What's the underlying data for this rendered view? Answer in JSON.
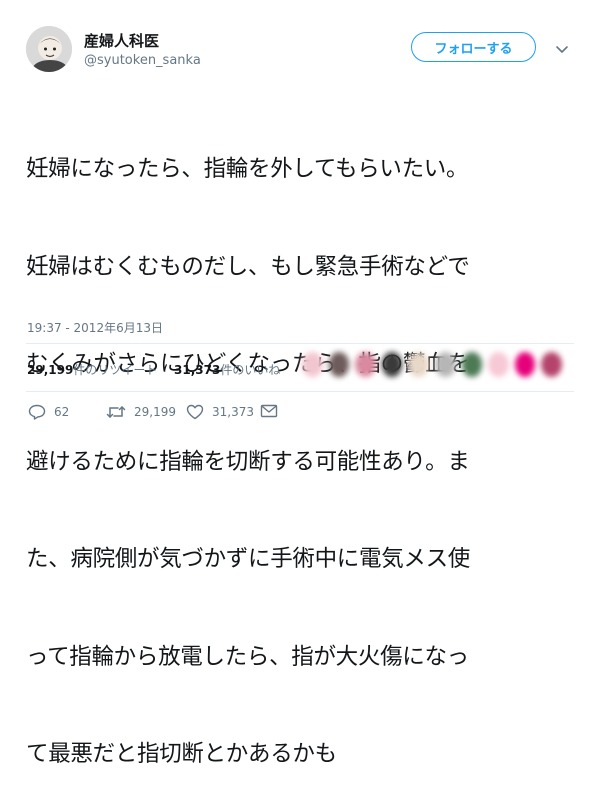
{
  "account": {
    "display_name": "産婦人科医",
    "handle": "@syutoken_sanka"
  },
  "follow_button_label": "フォローする",
  "tweet": {
    "lines": [
      "妊婦になったら、指輪を外してもらいたい。",
      "妊婦はむくむものだし、もし緊急手術などで",
      "むくみがさらにひどくなったら、指の鬱血を",
      "避けるために指輪を切断する可能性あり。ま",
      "た、病院側が気づかずに手術中に電気メス使",
      "って指輪から放電したら、指が大火傷になっ",
      "て最悪だと指切断とかあるかも"
    ],
    "timestamp": "19:37 - 2012年6月13日"
  },
  "stats": {
    "retweets_count": "29,199",
    "retweets_label": "件のリツイート",
    "likes_count": "31,373",
    "likes_label": "件のいいね"
  },
  "likers": {
    "colors": [
      "#f2c6cf",
      "#6e5b5b",
      "#d98aa0",
      "#3a3a3a",
      "#e8d8c8",
      "#b6b6b6",
      "#4d7a55",
      "#f7c8d6",
      "#e6007a",
      "#b5436b"
    ]
  },
  "actions": {
    "reply_count": "62",
    "retweet_count": "29,199",
    "like_count": "31,373"
  },
  "icons": {
    "reply": "reply-icon",
    "retweet": "retweet-icon",
    "like": "heart-icon",
    "dm": "envelope-icon",
    "more": "chevron-down-icon"
  },
  "colors": {
    "accent": "#1da1f2",
    "text": "#14171a",
    "muted": "#657786",
    "divider": "#e6ecf0"
  }
}
